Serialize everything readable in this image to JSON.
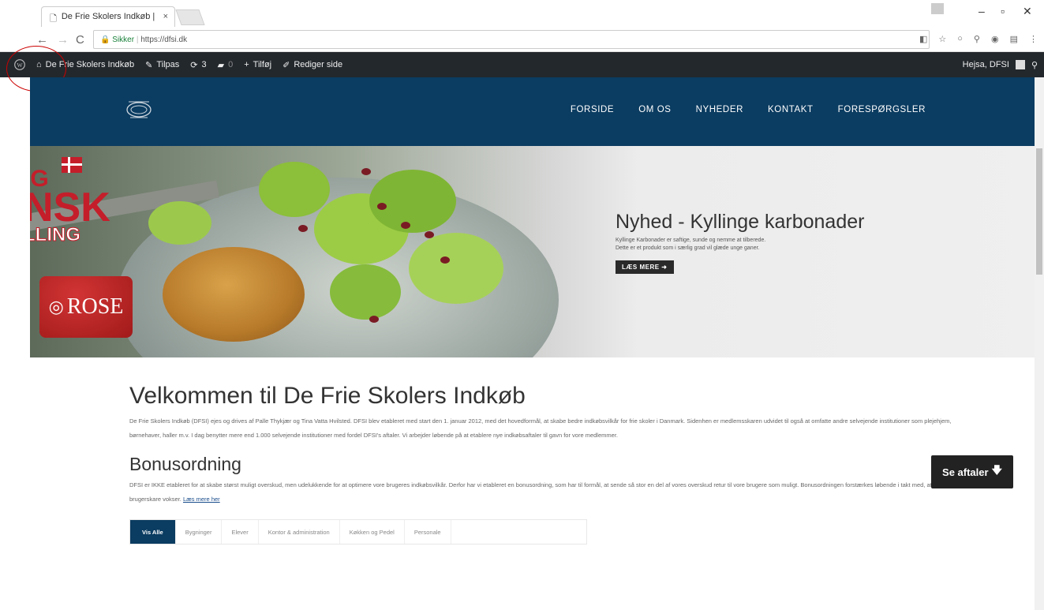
{
  "browser": {
    "tab_title": "De Frie Skolers Indkøb |",
    "tab_close": "×",
    "security_label": "Sikker",
    "url": "https://dfsi.dk"
  },
  "adminbar": {
    "site_name": "De Frie Skolers Indkøb",
    "customize": "Tilpas",
    "updates_count": "3",
    "comments_count": "0",
    "new_label": "Tilføj",
    "edit_page": "Rediger side",
    "greeting": "Hejsa, DFSI"
  },
  "nav": {
    "items": [
      "FORSIDE",
      "OM OS",
      "NYHEDER",
      "KONTAKT",
      "FORESPØRGSLER"
    ]
  },
  "hero": {
    "badge_text": "NSK",
    "badge_top": "IG",
    "badge_bottom": "LLING",
    "brand": "ROSE",
    "title": "Nyhed - Kyllinge karbonader",
    "desc1": "Kyllinge Karbonader er saftige, sunde og nemme at tilberede.",
    "desc2": "Dette er et produkt som i særlig grad vil glæde unge ganer.",
    "cta": "LÆS MERE"
  },
  "content": {
    "heading": "Velkommen til De Frie Skolers Indkøb",
    "intro": "De Frie Skolers Indkøb (DFSI) ejes og drives af Palle Thykjær og Tina Vatta Hvilsted. DFSI blev etableret med start den 1. januar 2012, med det hovedformål, at skabe bedre indkøbsvilkår for frie skoler i Danmark. Sidenhen er medlemsskaren udvidet til også at omfatte andre selvejende institutioner som plejehjem, børnehaver, haller m.v. I dag benytter mere end 1.000 selvejende institutioner med fordel DFSI's aftaler. Vi arbejder løbende på at etablere nye indkøbsaftaler til gavn for vore medlemmer.",
    "bonus_heading": "Bonusordning",
    "bonus_text": "DFSI er IKKE etableret for at skabe størst muligt overskud, men udelukkende for at optimere vore brugeres indkøbsvilkår. Derfor har vi etableret en bonusordning, som har til formål, at sende så stor en del af vores overskud retur til vore brugere som muligt. Bonusordningen forstærkes løbende i takt med, at DFSI's brugerskare vokser.",
    "bonus_link": "Læs mere her",
    "tabs": [
      "Vis Alle",
      "Bygninger",
      "Elever",
      "Kontor & administration",
      "Køkken og Pedel",
      "Personale"
    ],
    "se_aftaler": "Se aftaler"
  }
}
